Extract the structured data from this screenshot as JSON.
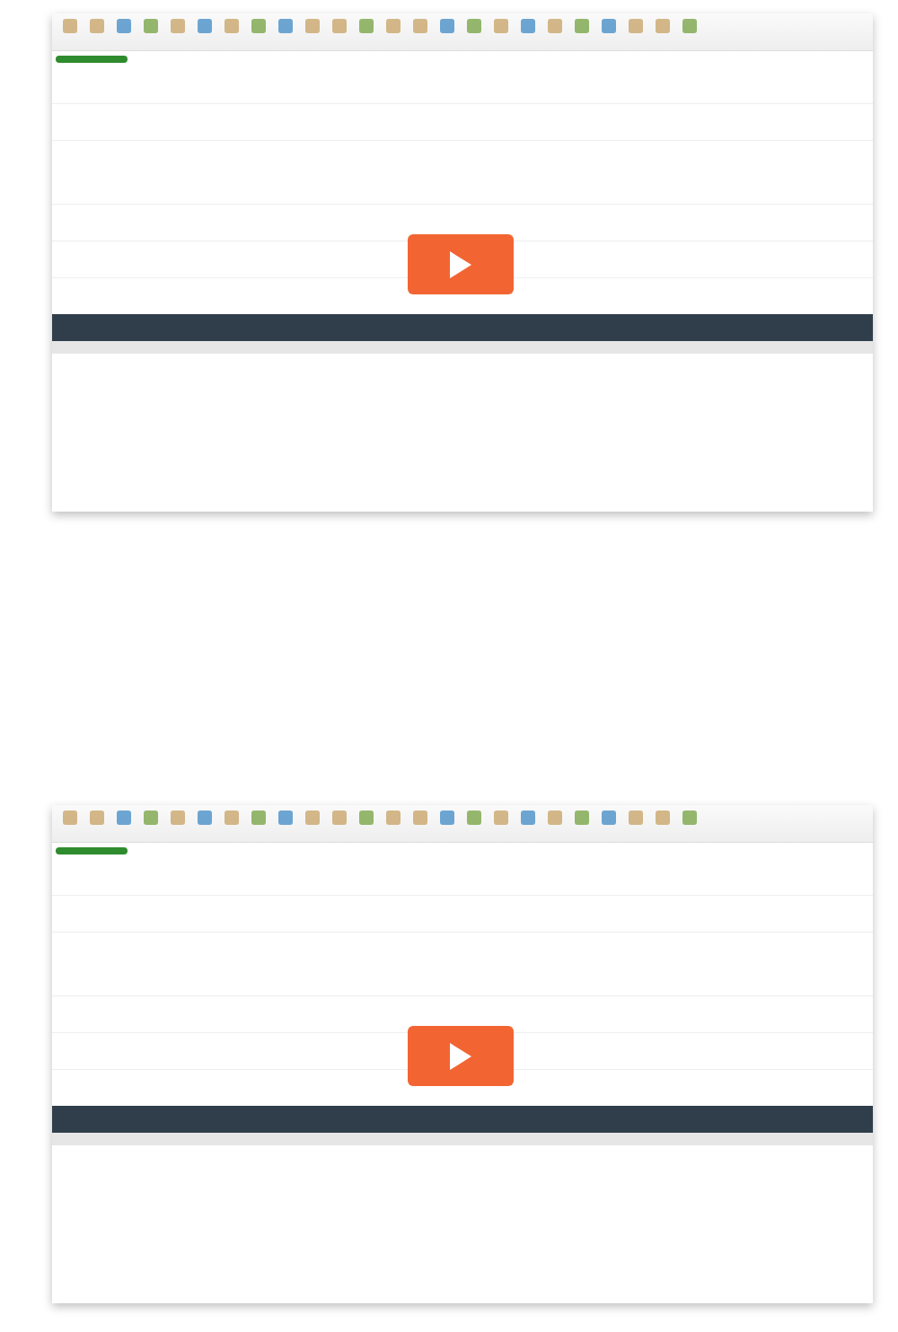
{
  "videos": [
    {
      "kind": "video"
    },
    {
      "kind": "video"
    }
  ]
}
